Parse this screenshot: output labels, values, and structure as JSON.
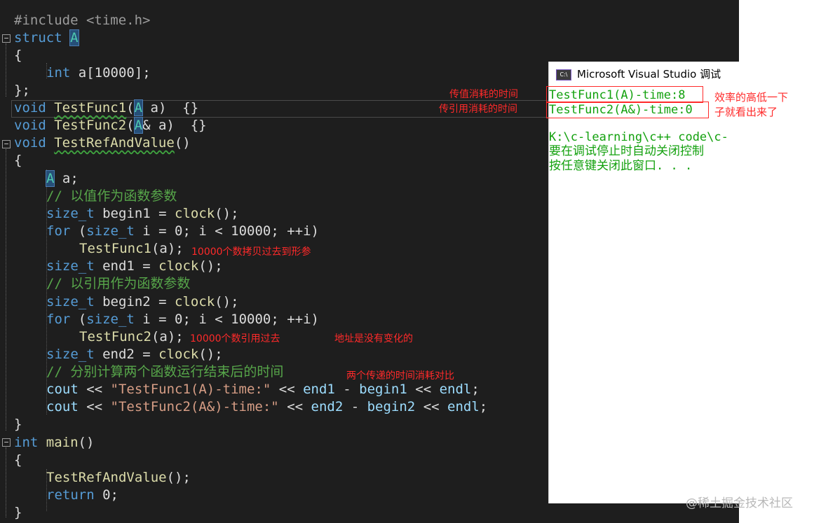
{
  "editor": {
    "lines": {
      "l1": {
        "a": "#include <time.h>"
      },
      "l2": {
        "a": "struct ",
        "b": "A"
      },
      "l3": {
        "a": "{"
      },
      "l4": {
        "a": "int",
        "b": " a[10000];"
      },
      "l5": {
        "a": "};"
      },
      "l6": {
        "a": "void",
        "b": " ",
        "c": "TestFunc1",
        "d": "(",
        "e": "A",
        "f": " a)  {}"
      },
      "l7": {
        "a": "void",
        "b": " ",
        "c": "TestFunc2",
        "d": "(",
        "e": "A",
        "f": "& a)  {}"
      },
      "l8": {
        "a": "void",
        "b": " ",
        "c": "TestRefAndValue",
        "d": "()"
      },
      "l9": {
        "a": "{"
      },
      "l10": {
        "a": "A",
        "b": " a;"
      },
      "l11": {
        "a": "// 以值作为函数参数"
      },
      "l12": {
        "a": "size_t",
        "b": " begin1 = ",
        "c": "clock",
        "d": "();"
      },
      "l13": {
        "a": "for",
        "b": " (",
        "c": "size_t",
        "d": " i = 0; i < 10000; ++i)"
      },
      "l14": {
        "a": "TestFunc1",
        "b": "(a);"
      },
      "l15": {
        "a": "size_t",
        "b": " end1 = ",
        "c": "clock",
        "d": "();"
      },
      "l16": {
        "a": "// 以引用作为函数参数"
      },
      "l17": {
        "a": "size_t",
        "b": " begin2 = ",
        "c": "clock",
        "d": "();"
      },
      "l18": {
        "a": "for",
        "b": " (",
        "c": "size_t",
        "d": " i = 0; i < 10000; ++i)"
      },
      "l19": {
        "a": "TestFunc2",
        "b": "(a);"
      },
      "l20": {
        "a": "size_t",
        "b": " end2 = ",
        "c": "clock",
        "d": "();"
      },
      "l21": {
        "a": "// 分别计算两个函数运行结束后的时间"
      },
      "l22": {
        "a": "cout",
        "b": " << ",
        "c": "\"TestFunc1(A)-time:\"",
        "d": " << ",
        "e": "end1",
        "f": " - ",
        "g": "begin1",
        "h": " << ",
        "i": "endl",
        "j": ";"
      },
      "l23": {
        "a": "cout",
        "b": " << ",
        "c": "\"TestFunc2(A&)-time:\"",
        "d": " << ",
        "e": "end2",
        "f": " - ",
        "g": "begin2",
        "h": " << ",
        "i": "endl",
        "j": ";"
      },
      "l24": {
        "a": "}"
      },
      "l25": {
        "a": "int",
        "b": " ",
        "c": "main",
        "d": "()"
      },
      "l26": {
        "a": "{"
      },
      "l27": {
        "a": "TestRefAndValue",
        "b": "();"
      },
      "l28": {
        "a": "return",
        "b": " 0;"
      },
      "l29": {
        "a": "}"
      }
    }
  },
  "annotations": {
    "value_cost": "传值消耗的时间",
    "ref_cost": "传引用消耗的时间",
    "efficiency_1": "效率的高低一下",
    "efficiency_2": "子就看出来了",
    "copy_note": "10000个数拷贝过去到形参",
    "ref_note": "10000个数引用过去",
    "addr_note": "地址是没有变化的",
    "compare_note": "两个传递的时间消耗对比"
  },
  "console": {
    "icon_text": "C:\\",
    "title": "Microsoft Visual Studio 调试",
    "out1": "TestFunc1(A)-time:8",
    "out2": "TestFunc2(A&)-time:0",
    "path": "K:\\c-learning\\c++ code\\c-",
    "msg1": "要在调试停止时自动关闭控制",
    "msg2": "按任意键关闭此窗口. . ."
  },
  "watermark": "@稀土掘金技术社区",
  "colors": {
    "editor_bg": "#1e1e1e",
    "keyword": "#569cd6",
    "comment": "#57a64a",
    "console_text": "#13a10e",
    "annotation_red": "#ff2a2a"
  }
}
